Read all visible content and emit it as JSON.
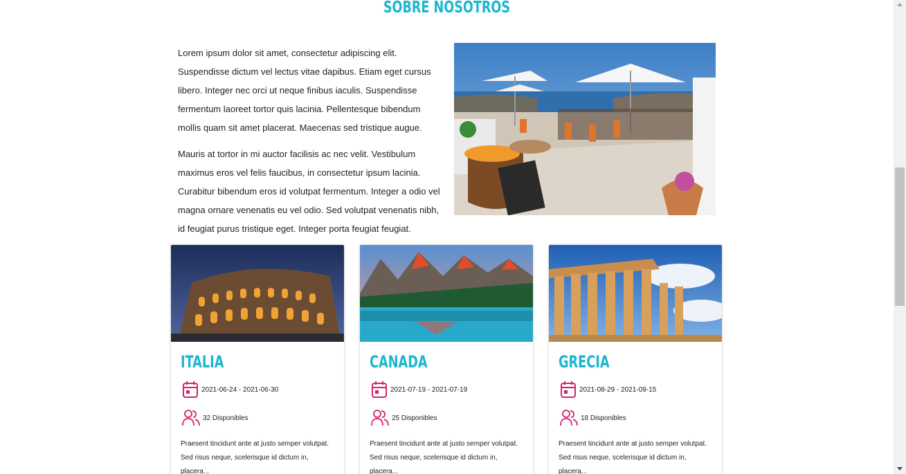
{
  "about": {
    "title": "SOBRE NOSOTROS",
    "paragraph_1": "Lorem ipsum dolor sit amet, consectetur adipiscing elit. Suspendisse dictum vel lectus vitae dapibus. Etiam eget cursus libero. Integer nec orci ut neque finibus iaculis. Suspendisse fermentum laoreet tortor quis lacinia. Pellentesque bibendum mollis quam sit amet placerat. Maecenas sed tristique augue.",
    "paragraph_2": "Mauris at tortor in mi auctor facilisis ac nec velit. Vestibulum maximus eros vel felis faucibus, in consectetur ipsum lacinia. Curabitur bibendum eros id volutpat fermentum. Integer a odio vel magna ornare venenatis eu vel odio. Sed volutpat venenatis nibh, id feugiat purus tristique eget. Integer porta feugiat feugiat."
  },
  "colors": {
    "accent": "#1ab6cf",
    "icon": "#d6206e"
  },
  "trips": [
    {
      "name": "ITALIA",
      "dates": "2021-06-24 - 2021-06-30",
      "available": "32 Disponibles",
      "description": "Praesent tincidunt ante at justo semper volutpat. Sed risus neque, scelerisque id dictum in, placera..."
    },
    {
      "name": "CANADA",
      "dates": "2021-07-19 - 2021-07-19",
      "available": "25 Disponibles",
      "description": "Praesent tincidunt ante at justo semper volutpat. Sed risus neque, scelerisque id dictum in, placera..."
    },
    {
      "name": "GRECIA",
      "dates": "2021-08-29 - 2021-09-15",
      "available": "18 Disponibles",
      "description": "Praesent tincidunt ante at justo semper volutpat. Sed risus neque, scelerisque id dictum in, placera..."
    }
  ],
  "icons": {
    "calendar": "calendar-icon",
    "people": "users-icon"
  }
}
